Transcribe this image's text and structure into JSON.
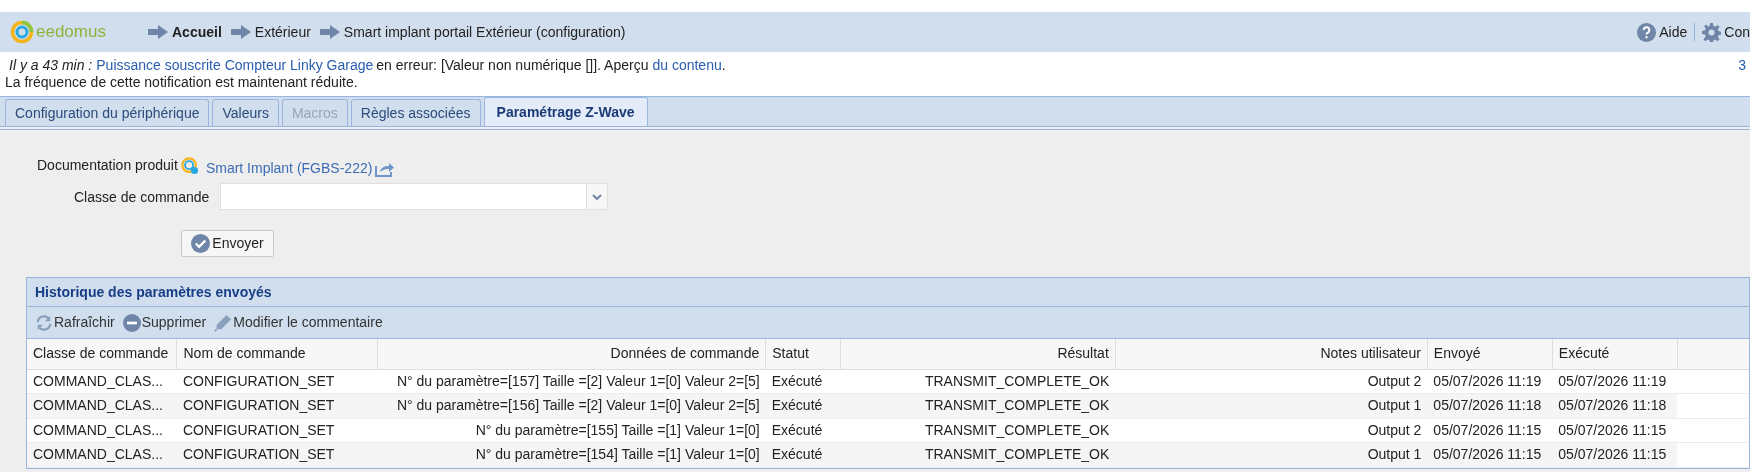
{
  "header": {
    "logo": "eedomus",
    "breadcrumb": [
      {
        "label": "Accueil",
        "current": true
      },
      {
        "label": "Extérieur",
        "current": false
      },
      {
        "label": "Smart implant portail Extérieur (configuration)",
        "current": false
      }
    ],
    "actions": [
      {
        "kind": "help",
        "label": "Aide"
      },
      {
        "kind": "settings",
        "label": "Con"
      }
    ]
  },
  "notification": {
    "parts": [
      {
        "kind": "time",
        "text": "Il y a 43 min :"
      },
      {
        "kind": "link",
        "text": "Puissance souscrite Compteur Linky Garage"
      },
      {
        "kind": "text",
        "text": "en erreur: [Valeur non numérique []]. Aperçu"
      },
      {
        "kind": "link",
        "text": "du contenu"
      },
      {
        "kind": "text",
        "text": "."
      }
    ],
    "second_line": "La fréquence de cette notification est maintenant réduite.",
    "count": "3"
  },
  "tabs": [
    {
      "label": "Configuration du périphérique",
      "selected": false,
      "disabled": false
    },
    {
      "label": "Valeurs",
      "selected": false,
      "disabled": false
    },
    {
      "label": "Macros",
      "selected": false,
      "disabled": true
    },
    {
      "label": "Règles associées",
      "selected": false,
      "disabled": false
    },
    {
      "label": "Paramétrage Z-Wave",
      "selected": true,
      "disabled": false
    }
  ],
  "form": {
    "doc_label": "Documentation produit",
    "doc_link": "Smart Implant (FGBS-222)",
    "class_label": "Classe de commande",
    "submit": "Envoyer"
  },
  "history": {
    "title": "Historique des paramètres envoyés",
    "toolbar": [
      {
        "kind": "refresh",
        "label": "Rafraîchir"
      },
      {
        "kind": "delete",
        "label": "Supprimer"
      },
      {
        "kind": "edit",
        "label": "Modifier le commentaire"
      }
    ],
    "columns": [
      "Classe de commande",
      "Nom de commande",
      "Données de commande",
      "Statut",
      "Résultat",
      "Notes utilisateur",
      "Envoyé",
      "Exécuté"
    ],
    "rows": [
      [
        "COMMAND_CLAS...",
        "CONFIGURATION_SET",
        "N° du paramètre=[157] Taille =[2] Valeur 1=[0] Valeur 2=[5]",
        "Exécuté",
        "TRANSMIT_COMPLETE_OK",
        "Output 2",
        "05/07/2026 11:19",
        "05/07/2026 11:19"
      ],
      [
        "COMMAND_CLAS...",
        "CONFIGURATION_SET",
        "N° du paramètre=[156] Taille =[2] Valeur 1=[0] Valeur 2=[5]",
        "Exécuté",
        "TRANSMIT_COMPLETE_OK",
        "Output 1",
        "05/07/2026 11:18",
        "05/07/2026 11:18"
      ],
      [
        "COMMAND_CLAS...",
        "CONFIGURATION_SET",
        "N° du paramètre=[155] Taille =[1] Valeur 1=[0]",
        "Exécuté",
        "TRANSMIT_COMPLETE_OK",
        "Output 2",
        "05/07/2026 11:15",
        "05/07/2026 11:15"
      ],
      [
        "COMMAND_CLAS...",
        "CONFIGURATION_SET",
        "N° du paramètre=[154] Taille =[1] Valeur 1=[0]",
        "Exécuté",
        "TRANSMIT_COMPLETE_OK",
        "Output 1",
        "05/07/2026 11:15",
        "05/07/2026 11:15"
      ]
    ]
  }
}
